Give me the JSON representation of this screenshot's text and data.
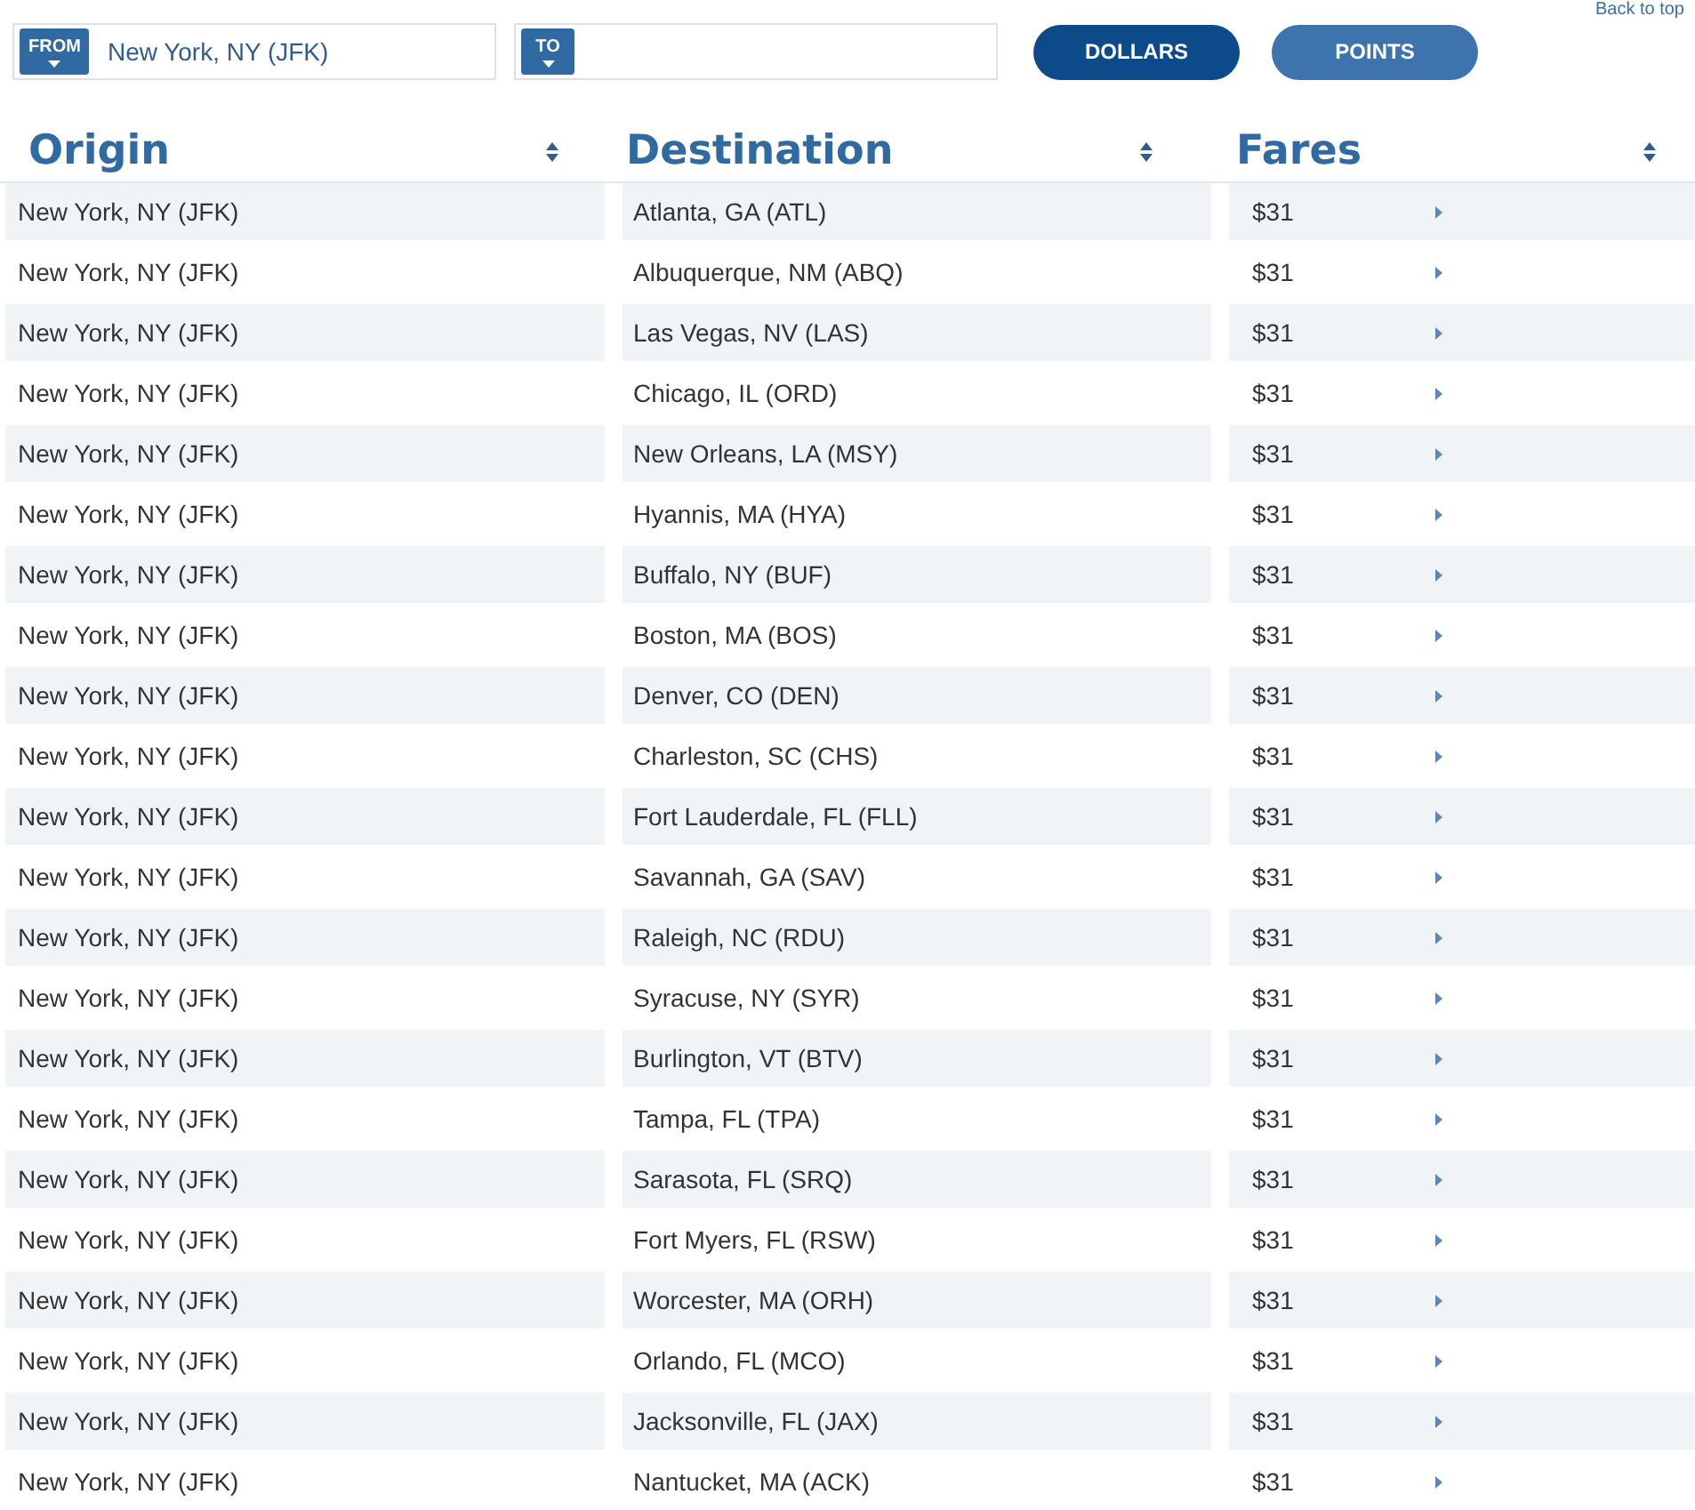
{
  "back_link": "Back to top",
  "search": {
    "from": {
      "label": "FROM",
      "value": "New York, NY (JFK)"
    },
    "to": {
      "label": "TO"
    }
  },
  "currency_toggle": [
    {
      "label": "DOLLARS",
      "selected": true
    },
    {
      "label": "POINTS",
      "selected": false
    }
  ],
  "table": {
    "columns": [
      "Origin",
      "Destination",
      "Fares"
    ],
    "rows": [
      {
        "origin": "New York, NY (JFK)",
        "destination": "Atlanta, GA (ATL)",
        "fare": "$31"
      },
      {
        "origin": "New York, NY (JFK)",
        "destination": "Albuquerque, NM (ABQ)",
        "fare": "$31"
      },
      {
        "origin": "New York, NY (JFK)",
        "destination": "Las Vegas, NV (LAS)",
        "fare": "$31"
      },
      {
        "origin": "New York, NY (JFK)",
        "destination": "Chicago, IL (ORD)",
        "fare": "$31"
      },
      {
        "origin": "New York, NY (JFK)",
        "destination": "New Orleans, LA (MSY)",
        "fare": "$31"
      },
      {
        "origin": "New York, NY (JFK)",
        "destination": "Hyannis, MA (HYA)",
        "fare": "$31"
      },
      {
        "origin": "New York, NY (JFK)",
        "destination": "Buffalo, NY (BUF)",
        "fare": "$31"
      },
      {
        "origin": "New York, NY (JFK)",
        "destination": "Boston, MA (BOS)",
        "fare": "$31"
      },
      {
        "origin": "New York, NY (JFK)",
        "destination": "Denver, CO (DEN)",
        "fare": "$31"
      },
      {
        "origin": "New York, NY (JFK)",
        "destination": "Charleston, SC (CHS)",
        "fare": "$31"
      },
      {
        "origin": "New York, NY (JFK)",
        "destination": "Fort Lauderdale, FL (FLL)",
        "fare": "$31"
      },
      {
        "origin": "New York, NY (JFK)",
        "destination": "Savannah, GA (SAV)",
        "fare": "$31"
      },
      {
        "origin": "New York, NY (JFK)",
        "destination": "Raleigh, NC (RDU)",
        "fare": "$31"
      },
      {
        "origin": "New York, NY (JFK)",
        "destination": "Syracuse, NY (SYR)",
        "fare": "$31"
      },
      {
        "origin": "New York, NY (JFK)",
        "destination": "Burlington, VT (BTV)",
        "fare": "$31"
      },
      {
        "origin": "New York, NY (JFK)",
        "destination": "Tampa, FL (TPA)",
        "fare": "$31"
      },
      {
        "origin": "New York, NY (JFK)",
        "destination": "Sarasota, FL (SRQ)",
        "fare": "$31"
      },
      {
        "origin": "New York, NY (JFK)",
        "destination": "Fort Myers, FL (RSW)",
        "fare": "$31"
      },
      {
        "origin": "New York, NY (JFK)",
        "destination": "Worcester, MA (ORH)",
        "fare": "$31"
      },
      {
        "origin": "New York, NY (JFK)",
        "destination": "Orlando, FL (MCO)",
        "fare": "$31"
      },
      {
        "origin": "New York, NY (JFK)",
        "destination": "Jacksonville, FL (JAX)",
        "fare": "$31"
      },
      {
        "origin": "New York, NY (JFK)",
        "destination": "Nantucket, MA (ACK)",
        "fare": "$31"
      }
    ]
  }
}
